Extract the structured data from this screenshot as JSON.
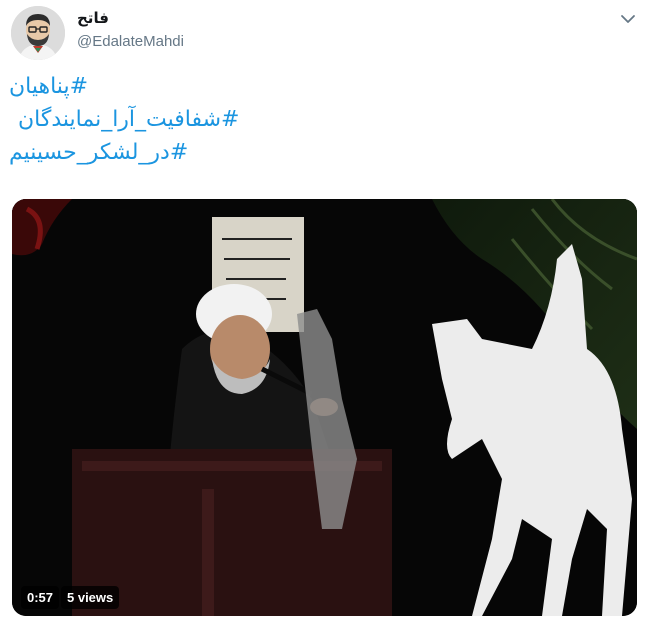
{
  "author": {
    "display_name": "فاتح",
    "handle": "@EdalateMahdi"
  },
  "tweet": {
    "hashtags": [
      "#پناهیان",
      "#شفافیت_آرا_نمایندگان",
      "#در_لشکر_حسینیم"
    ]
  },
  "video": {
    "duration": "0:57",
    "views": "5 views"
  },
  "colors": {
    "link": "#1b95e0",
    "name": "#14171a",
    "handle": "#657786",
    "badge_bg": "#000000"
  },
  "icons": {
    "menu": "chevron-down-icon",
    "avatar": "cartoon-avatar"
  }
}
